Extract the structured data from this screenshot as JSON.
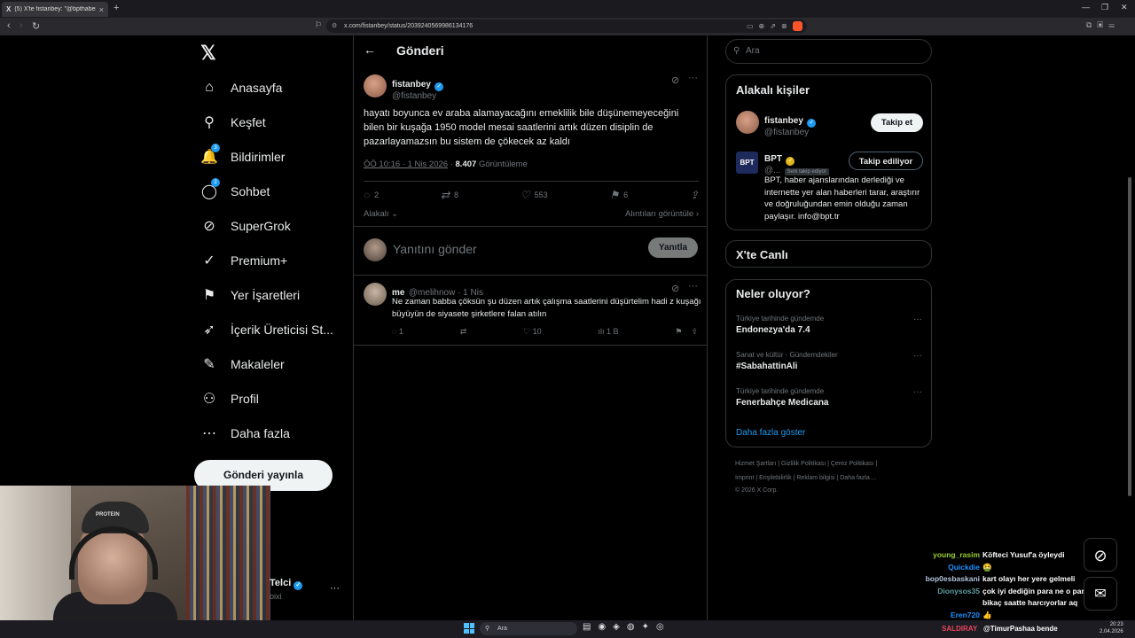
{
  "browser": {
    "tab_title": "(5) X'te fistanbey: \"@bpthaber h...",
    "url": "x.com/fistanbey/status/2039240569986134176"
  },
  "nav": {
    "items": [
      {
        "label": "Anasayfa",
        "icon": "home-icon",
        "glyph": "⌂"
      },
      {
        "label": "Keşfet",
        "icon": "search-icon",
        "glyph": "⚲"
      },
      {
        "label": "Bildirimler",
        "icon": "bell-icon",
        "glyph": "🔔",
        "badge": "3"
      },
      {
        "label": "Sohbet",
        "icon": "chat-icon",
        "glyph": "◯",
        "badge": "2"
      },
      {
        "label": "SuperGrok",
        "icon": "grok-icon",
        "glyph": "⊘"
      },
      {
        "label": "Premium+",
        "icon": "premium-icon",
        "glyph": "✓"
      },
      {
        "label": "Yer İşaretleri",
        "icon": "bookmark-icon",
        "glyph": "⚑"
      },
      {
        "label": "İçerik Üreticisi St...",
        "icon": "rocket-icon",
        "glyph": "➶"
      },
      {
        "label": "Makaleler",
        "icon": "article-icon",
        "glyph": "✎"
      },
      {
        "label": "Profil",
        "icon": "profile-icon",
        "glyph": "⚇"
      },
      {
        "label": "Daha fazla",
        "icon": "more-icon",
        "glyph": "⋯"
      }
    ],
    "post_button": "Gönderi yayınla"
  },
  "header": {
    "title": "Gönderi"
  },
  "tweet": {
    "name": "fistanbey",
    "handle": "@fistanbey",
    "text": "hayatı boyunca ev araba alamayacağını emeklilik bile düşünemeyeceğini bilen bir kuşağa 1950 model mesai saatlerini artık  düzen disiplin de pazarlayamazsın bu sistem de çökecek az kaldı",
    "time": "ÖÖ 10:16 · 1 Nis 2026",
    "views": "8.407",
    "views_label": "Görüntüleme",
    "replies": "2",
    "retweets": "8",
    "likes": "553",
    "bookmarks": "6"
  },
  "sort": {
    "left": "Alakalı",
    "right": "Alıntıları görüntüle"
  },
  "reply_box": {
    "placeholder": "Yanıtını gönder",
    "button": "Yanıtla"
  },
  "reply": {
    "name": "me",
    "handle": "@melihnow · 1 Nis",
    "text": "Ne zaman babba çöksün şu düzen artık çalışma saatlerini düşürtelim hadi z kuşağı büyüyün de siyasete şirketlere falan atılın",
    "replies": "1",
    "likes": "10",
    "views": "1 B"
  },
  "search": {
    "placeholder": "Ara"
  },
  "related": {
    "title": "Alakalı kişiler",
    "person1": {
      "name": "fistanbey",
      "handle": "@fistanbey",
      "button": "Takip et"
    },
    "person2": {
      "name": "BPT",
      "handle": "@...",
      "follows_you": "Seni takip ediyor",
      "button": "Takip ediliyor",
      "logo": "BPT",
      "bio": "BPT, haber ajanslarından derlediği ve internette yer alan haberleri tarar, araştırır ve doğruluğundan emin olduğu zaman paylaşır. info@bpt.tr"
    }
  },
  "live": {
    "title": "X'te Canlı"
  },
  "trends": {
    "title": "Neler oluyor?",
    "items": [
      {
        "context": "Türkiye tarihinde gündemde",
        "topic": "Endonezya'da 7.4"
      },
      {
        "context": "Sanat ve kültür · Gündemdekiler",
        "topic": "#SabahattinAli"
      },
      {
        "context": "Türkiye tarihinde gündemde",
        "topic": "Fenerbahçe Medicana"
      }
    ],
    "show_more": "Daha fazla göster"
  },
  "footer": {
    "line1": "Hizmet Şartları  |  Gizlilik Politikası  |  Çerez Politikası  |",
    "line2": "Imprint  |  Erişilebilirlik  |  Reklam bilgisi  |  Daha fazla ...",
    "line3": "© 2026 X Corp."
  },
  "pinned_account": {
    "name": "Telci",
    "handle": "oixi"
  },
  "chat": [
    {
      "user": "young_rasim",
      "color": "#9acd32",
      "msg": "Köfteci Yusuf'a öyleydi"
    },
    {
      "user": "Quickdie",
      "color": "#1e90ff",
      "msg": "🤮"
    },
    {
      "user": "bop0esbaskani",
      "color": "#b0c4de",
      "msg": "kart olayı her yere gelmeli"
    },
    {
      "user": "Dionysos35",
      "color": "#5f9ea0",
      "msg": "çok iyi dediğin para ne o paraları"
    },
    {
      "user": "",
      "color": "#fff",
      "msg": "bikaç saatte harcıyorlar aq"
    },
    {
      "user": "Eren720",
      "color": "#1e90ff",
      "msg": "👍"
    }
  ],
  "tray": {
    "user": "SALDIRAY",
    "msg": "@TimurPashaa bende"
  },
  "taskbar": {
    "search": "Ara",
    "time": "20:23",
    "date": "2.04.2026"
  },
  "colors": {
    "accent": "#1d9bf0",
    "background": "#000000",
    "border": "#2f3336",
    "muted": "#71767b"
  }
}
